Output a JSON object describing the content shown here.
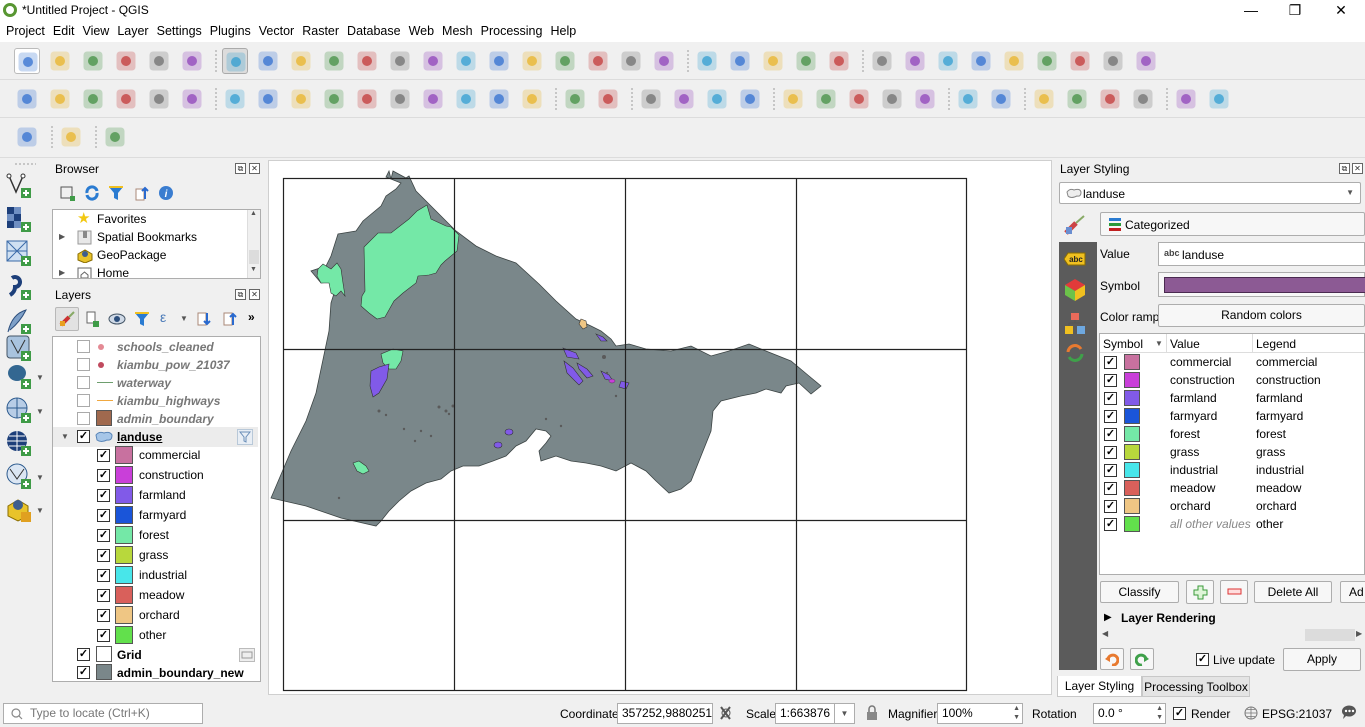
{
  "window": {
    "title": "*Untitled Project - QGIS",
    "minimize": "—",
    "restore": "❐",
    "close": "✕"
  },
  "menu": [
    "Project",
    "Edit",
    "View",
    "Layer",
    "Settings",
    "Plugins",
    "Vector",
    "Raster",
    "Database",
    "Web",
    "Mesh",
    "Processing",
    "Help"
  ],
  "toolbars": {
    "row1": [
      "new-project",
      "open-project",
      "save-project",
      "new-print-layout",
      "layout-manager",
      "style-manager",
      "pan-map",
      "pan-to-selection",
      "zoom-in",
      "zoom-out",
      "zoom-full",
      "zoom-to-selection",
      "zoom-to-layer",
      "zoom-native",
      "zoom-last",
      "zoom-next",
      "new-map-view",
      "new-3d-map-view",
      "new-bookmark",
      "show-bookmarks",
      "refresh",
      "identify",
      "run-action",
      "select-features",
      "select-by-value",
      "deselect-all",
      "open-attribute-table",
      "open-field-calculator",
      "statistical-summary",
      "toolbox",
      "show-statistical-summary",
      "measure",
      "map-tips",
      "text-annotation"
    ],
    "row2": [
      "data-source-manager",
      "new-geopackage-layer",
      "new-shapefile-layer",
      "new-spatialite-layer",
      "new-temporary-layer",
      "new-virtual-layer",
      "current-edits",
      "toggle-editing",
      "save-edits",
      "digitize",
      "vertex-tool",
      "modify-attributes",
      "delete-selected",
      "cut-features",
      "copy-features",
      "paste-features",
      "undo",
      "redo",
      "layer-labeling",
      "layer-diagram",
      "pin-labels",
      "show-hide-labels",
      "move-label",
      "rotate-label",
      "change-label",
      "show-unplaced",
      "label-toolbar",
      "metasearch",
      "metasearch-browse",
      "python-console",
      "raster-calculator",
      "osm-plugin",
      "help",
      "georeferencer",
      "refresh-plugin"
    ],
    "row3": [
      "profile-tool",
      "locator",
      "qgis2web"
    ]
  },
  "browser": {
    "title": "Browser",
    "items": [
      {
        "label": "Favorites",
        "icon": "star-icon",
        "expandable": false
      },
      {
        "label": "Spatial Bookmarks",
        "icon": "bookmark-icon",
        "expandable": true
      },
      {
        "label": "GeoPackage",
        "icon": "geopackage-icon",
        "expandable": false
      },
      {
        "label": "Home",
        "icon": "home-icon",
        "expandable": true
      }
    ]
  },
  "layers": {
    "title": "Layers",
    "items": [
      {
        "label": "schools_cleaned",
        "checked": false,
        "symbol": "point",
        "color": "#e48a94",
        "style": "inactive"
      },
      {
        "label": "kiambu_pow_21037",
        "checked": false,
        "symbol": "point",
        "color": "#c04a5e",
        "style": "inactive"
      },
      {
        "label": "waterway",
        "checked": false,
        "symbol": "line",
        "color": "#6e9e6e",
        "style": "inactive"
      },
      {
        "label": "kiambu_highways",
        "checked": false,
        "symbol": "line",
        "color": "#f0a840",
        "style": "inactive"
      },
      {
        "label": "admin_boundary",
        "checked": false,
        "symbol": "fill",
        "color": "#a0694e",
        "style": "inactive"
      }
    ],
    "landuse": {
      "label": "landuse",
      "checked": true,
      "categories": [
        {
          "label": "commercial",
          "color": "#c8719f",
          "checked": true
        },
        {
          "label": "construction",
          "color": "#c93fd9",
          "checked": true
        },
        {
          "label": "farmland",
          "color": "#815ae8",
          "checked": true
        },
        {
          "label": "farmyard",
          "color": "#1a55d9",
          "checked": true
        },
        {
          "label": "forest",
          "color": "#74e8a7",
          "checked": true
        },
        {
          "label": "grass",
          "color": "#b8d83c",
          "checked": true
        },
        {
          "label": "industrial",
          "color": "#48e6ea",
          "checked": true
        },
        {
          "label": "meadow",
          "color": "#d9605b",
          "checked": true
        },
        {
          "label": "orchard",
          "color": "#efc684",
          "checked": true
        },
        {
          "label": "other",
          "color": "#62e04c",
          "checked": true
        }
      ]
    },
    "grid": {
      "label": "Grid",
      "checked": true,
      "color": "#ffffff"
    },
    "admin_new": {
      "label": "admin_boundary_new",
      "checked": true,
      "color": "#7a878a"
    }
  },
  "map": {
    "boundary_color": "#7a878a",
    "forest_color": "#74e8a7",
    "farmland_color": "#815ae8",
    "orchard_color": "#efc684"
  },
  "styling": {
    "title": "Layer Styling",
    "layer": "landuse",
    "renderer": "Categorized",
    "value_label": "Value",
    "value_prefix": "abc",
    "value": "landuse",
    "symbol_label": "Symbol",
    "symbol_color": "#8c5a94",
    "color_ramp_label": "Color ramp",
    "color_ramp": "Random colors",
    "columns": [
      "Symbol",
      "Value",
      "Legend"
    ],
    "rows": [
      {
        "value": "commercial",
        "legend": "commercial",
        "color": "#c8719f"
      },
      {
        "value": "construction",
        "legend": "construction",
        "color": "#c93fd9"
      },
      {
        "value": "farmland",
        "legend": "farmland",
        "color": "#815ae8"
      },
      {
        "value": "farmyard",
        "legend": "farmyard",
        "color": "#1a55d9"
      },
      {
        "value": "forest",
        "legend": "forest",
        "color": "#74e8a7"
      },
      {
        "value": "grass",
        "legend": "grass",
        "color": "#b8d83c"
      },
      {
        "value": "industrial",
        "legend": "industrial",
        "color": "#48e6ea"
      },
      {
        "value": "meadow",
        "legend": "meadow",
        "color": "#d9605b"
      },
      {
        "value": "orchard",
        "legend": "orchard",
        "color": "#efc684"
      },
      {
        "value": "all other values",
        "legend": "other",
        "color": "#62e04c",
        "italic": true
      }
    ],
    "classify": "Classify",
    "delete_all": "Delete All",
    "advanced": "Ad",
    "layer_rendering": "Layer Rendering",
    "live_update": "Live update",
    "apply": "Apply",
    "tabs": [
      "Layer Styling",
      "Processing Toolbox"
    ]
  },
  "status": {
    "locator_placeholder": "Type to locate (Ctrl+K)",
    "coordinate_label": "Coordinate",
    "coordinate": "357252,9880251",
    "scale_label": "Scale",
    "scale": "1:663876",
    "magnifier_label": "Magnifier",
    "magnifier": "100%",
    "rotation_label": "Rotation",
    "rotation": "0.0 °",
    "render_label": "Render",
    "crs": "EPSG:21037"
  }
}
